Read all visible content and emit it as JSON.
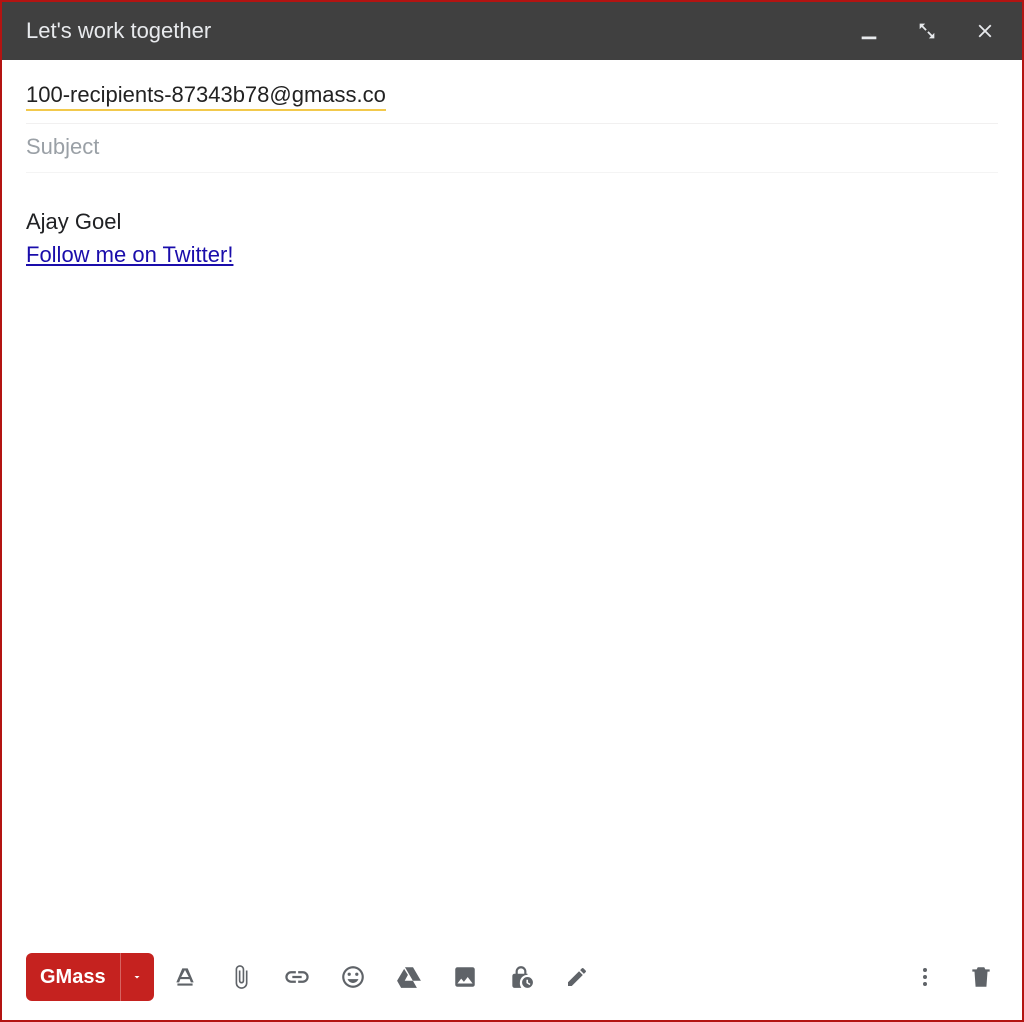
{
  "window": {
    "title": "Let's work together"
  },
  "compose": {
    "recipient": "100-recipients-87343b78@gmass.co",
    "subject_placeholder": "Subject",
    "subject_value": ""
  },
  "body": {
    "signature_name": "Ajay Goel",
    "signature_link_text": "Follow me on Twitter!"
  },
  "toolbar": {
    "send_label": "GMass"
  }
}
